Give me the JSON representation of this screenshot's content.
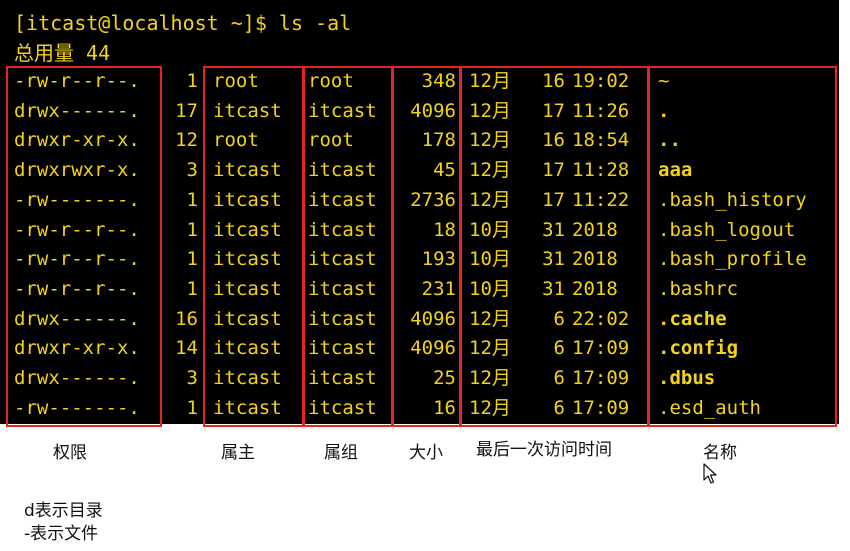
{
  "terminal": {
    "prompt": "[itcast@localhost ~]$ ls -al",
    "total": "总用量 44",
    "columns": [
      "perm",
      "links",
      "owner",
      "group",
      "size",
      "month",
      "day",
      "time",
      "name"
    ],
    "rows": [
      {
        "perm": "-rw-r--r--.",
        "links": "1",
        "owner": "root",
        "group": "root",
        "size": "348",
        "month": "12月",
        "day": "16",
        "time": "19:02",
        "name": "~",
        "bold": false
      },
      {
        "perm": "drwx------.",
        "links": "17",
        "owner": "itcast",
        "group": "itcast",
        "size": "4096",
        "month": "12月",
        "day": "17",
        "time": "11:26",
        "name": ".",
        "bold": true
      },
      {
        "perm": "drwxr-xr-x.",
        "links": "12",
        "owner": "root",
        "group": "root",
        "size": "178",
        "month": "12月",
        "day": "16",
        "time": "18:54",
        "name": "..",
        "bold": true
      },
      {
        "perm": "drwxrwxr-x.",
        "links": "3",
        "owner": "itcast",
        "group": "itcast",
        "size": "45",
        "month": "12月",
        "day": "17",
        "time": "11:28",
        "name": "aaa",
        "bold": true
      },
      {
        "perm": "-rw-------.",
        "links": "1",
        "owner": "itcast",
        "group": "itcast",
        "size": "2736",
        "month": "12月",
        "day": "17",
        "time": "11:22",
        "name": ".bash_history",
        "bold": false
      },
      {
        "perm": "-rw-r--r--.",
        "links": "1",
        "owner": "itcast",
        "group": "itcast",
        "size": "18",
        "month": "10月",
        "day": "31",
        "time": "2018",
        "name": ".bash_logout",
        "bold": false
      },
      {
        "perm": "-rw-r--r--.",
        "links": "1",
        "owner": "itcast",
        "group": "itcast",
        "size": "193",
        "month": "10月",
        "day": "31",
        "time": "2018",
        "name": ".bash_profile",
        "bold": false
      },
      {
        "perm": "-rw-r--r--.",
        "links": "1",
        "owner": "itcast",
        "group": "itcast",
        "size": "231",
        "month": "10月",
        "day": "31",
        "time": "2018",
        "name": ".bashrc",
        "bold": false
      },
      {
        "perm": "drwx------.",
        "links": "16",
        "owner": "itcast",
        "group": "itcast",
        "size": "4096",
        "month": "12月",
        "day": "6",
        "time": "22:02",
        "name": ".cache",
        "bold": true
      },
      {
        "perm": "drwxr-xr-x.",
        "links": "14",
        "owner": "itcast",
        "group": "itcast",
        "size": "4096",
        "month": "12月",
        "day": "6",
        "time": "17:09",
        "name": ".config",
        "bold": true
      },
      {
        "perm": "drwx------.",
        "links": "3",
        "owner": "itcast",
        "group": "itcast",
        "size": "25",
        "month": "12月",
        "day": "6",
        "time": "17:09",
        "name": ".dbus",
        "bold": true
      },
      {
        "perm": "-rw-------.",
        "links": "1",
        "owner": "itcast",
        "group": "itcast",
        "size": "16",
        "month": "12月",
        "day": "6",
        "time": "17:09",
        "name": ".esd_auth",
        "bold": false
      }
    ]
  },
  "annotations": {
    "labels": {
      "permissions": "权限",
      "owner": "属主",
      "group": "属组",
      "size": "大小",
      "last_access": "最后一次访问时间",
      "name": "名称"
    },
    "notes": [
      "d表示目录",
      "-表示文件"
    ],
    "box_color": "#e8241e"
  },
  "colors": {
    "terminal_bg": "#000000",
    "terminal_text": "#f2d21a",
    "annotation_text": "#111111"
  },
  "cursor_icon": "arrow-cursor-icon"
}
